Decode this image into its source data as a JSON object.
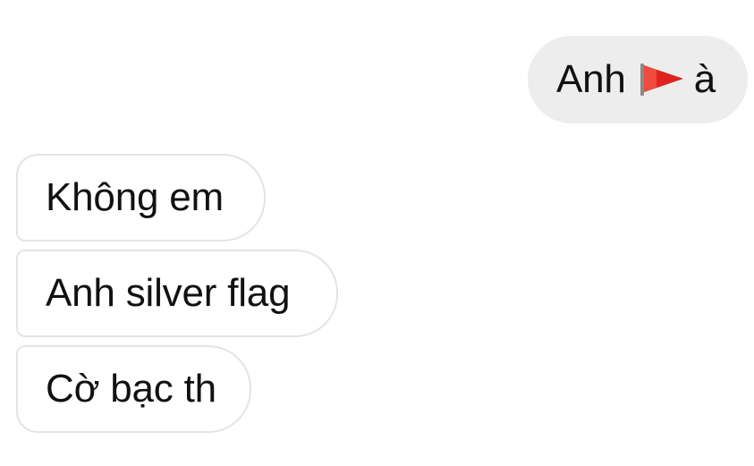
{
  "thread": {
    "outgoing": {
      "text_before": "Anh",
      "icon": "triangular-flag-emoji",
      "text_after": "à"
    },
    "incoming": [
      {
        "text": "Không em"
      },
      {
        "text": "Anh silver flag"
      },
      {
        "text": "Cờ bạc th"
      }
    ]
  },
  "colors": {
    "outgoing_bubble": "#ededed",
    "incoming_border": "#e4e4e4",
    "flag_red": "#e0231c"
  }
}
